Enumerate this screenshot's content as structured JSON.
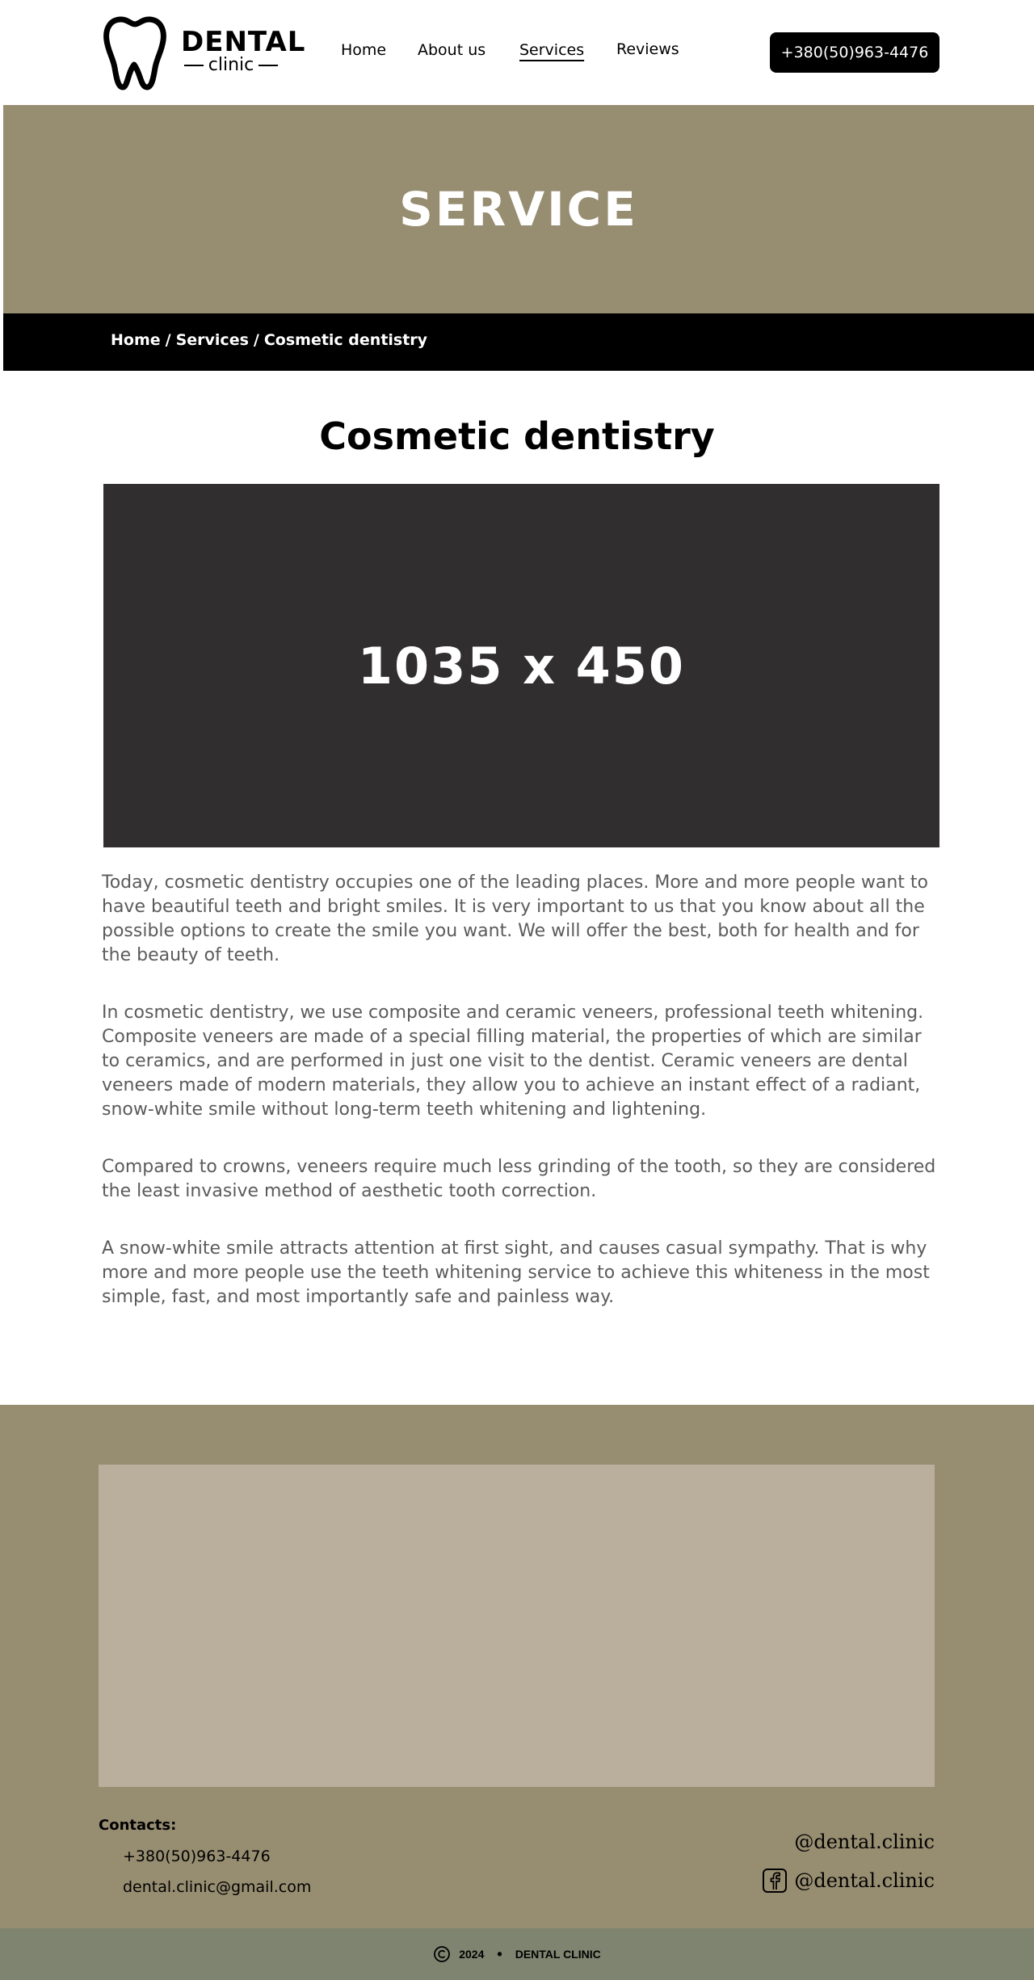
{
  "header": {
    "logo_title": "DENTAL",
    "logo_sub": "clinic",
    "nav": [
      {
        "label": "Home"
      },
      {
        "label": "About us"
      },
      {
        "label": "Services"
      },
      {
        "label": "Reviews"
      }
    ],
    "active_nav": "Services",
    "phone_button": "+380(50)963-4476"
  },
  "hero": {
    "title": "SERVICE",
    "background": "#978d71"
  },
  "breadcrumb": {
    "items": [
      "Home",
      "Services",
      "Cosmetic dentistry"
    ],
    "separator": "/"
  },
  "main": {
    "title": "Cosmetic dentistry",
    "image_label": "1035 x 450",
    "paragraphs": [
      "Today, cosmetic dentistry occupies one of the leading places. More and more  people want to have beautiful teeth and bright smiles. It is very  important to us that you know about all the possible options to create  the smile you want. We will offer the best, both for health and for the  beauty of teeth.",
      "In cosmetic dentistry, we use composite and ceramic veneers, professional  teeth whitening. Composite veneers are made of a special filling  material, the properties of which are similar to ceramics, and are  performed in just one visit to the dentist. Ceramic veneers are dental  veneers made of modern materials, they allow you to achieve an instant  effect of a radiant, snow-white smile without long-term teeth whitening  and lightening.",
      "Compared to crowns, veneers require much less grinding of the tooth, so they are considered the least invasive method of aesthetic tooth correction.",
      "A snow-white smile attracts attention at first sight, and causes casual  sympathy. That is why more and more people use the teeth whitening  service to achieve this whiteness in the most simple, fast, and most  importantly safe and painless way."
    ]
  },
  "footer": {
    "contacts_label": "Contacts:",
    "phone": "+380(50)963-4476",
    "email": "dental.clinic@gmail.com",
    "social_1": "@dental.clinic",
    "social_2": "@dental.clinic",
    "social_2_icon": "facebook-icon",
    "copyright_year": "2024",
    "copyright_name": "DENTAL CLINIC"
  },
  "colors": {
    "accent_khaki": "#978d71",
    "map_placeholder": "#baae9d",
    "bottom_bar": "#7f8470",
    "image_placeholder": "#302e2f"
  }
}
